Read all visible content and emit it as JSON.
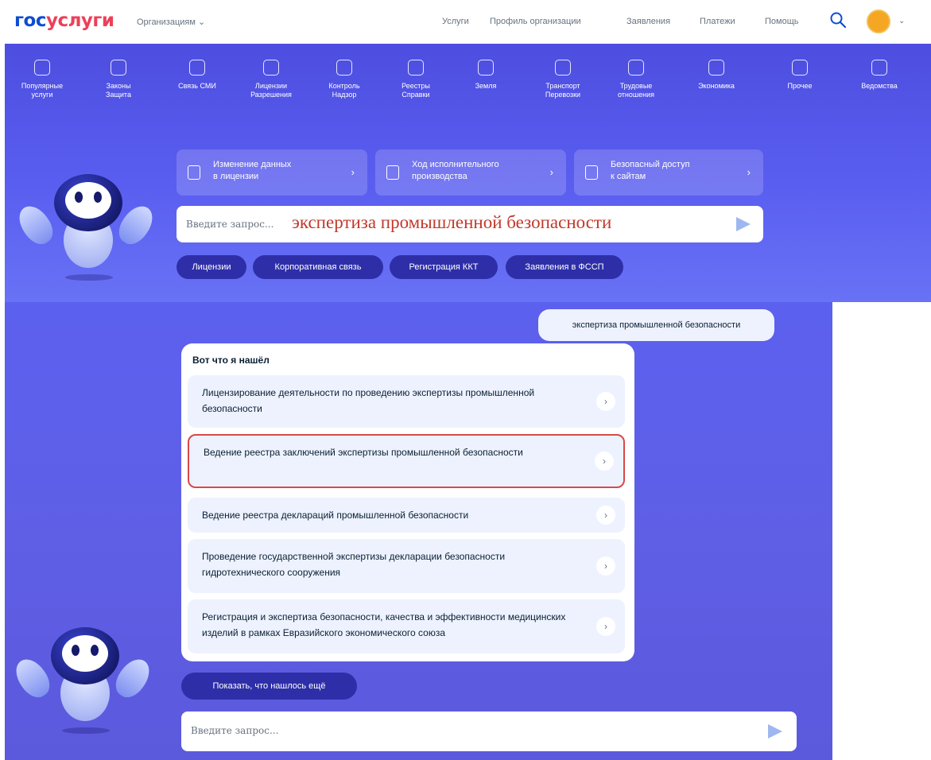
{
  "header": {
    "logo_part1": "гос",
    "logo_part2": "услуги",
    "org_menu": "Организациям ⌄",
    "nav": [
      "Услуги",
      "Профиль организации",
      "Заявления",
      "Платежи",
      "Помощь"
    ],
    "avatar_chevron": "⌄"
  },
  "categories": [
    {
      "label": "Популярные\nуслуги",
      "icon": "heart-icon"
    },
    {
      "label": "Законы\nЗащита",
      "icon": "hammer-icon"
    },
    {
      "label": "Связь СМИ",
      "icon": "antenna-icon"
    },
    {
      "label": "Лицензии\nРазрешения",
      "icon": "document-icon"
    },
    {
      "label": "Контроль\nНадзор",
      "icon": "edit-icon"
    },
    {
      "label": "Реестры\nСправки",
      "icon": "folder-icon"
    },
    {
      "label": "Земля",
      "icon": "house-icon"
    },
    {
      "label": "Транспорт\nПеревозки",
      "icon": "car-icon"
    },
    {
      "label": "Трудовые\nотношения",
      "icon": "briefcase-icon"
    },
    {
      "label": "Экономика",
      "icon": "bag-icon"
    },
    {
      "label": "Прочее",
      "icon": "grid-icon"
    },
    {
      "label": "Ведомства",
      "icon": "emblem-icon"
    }
  ],
  "quick_cards": [
    {
      "label": "Изменение данных\nв лицензии",
      "chevron": "›"
    },
    {
      "label": "Ход исполнительного\nпроизводства",
      "chevron": "›"
    },
    {
      "label": "Безопасный доступ\nк сайтам",
      "chevron": "›"
    }
  ],
  "top_search": {
    "placeholder": "Введите запрос...",
    "query": "экспертиза промышленной безопасности"
  },
  "chips": [
    "Лицензии",
    "Корпоративная связь",
    "Регистрация ККТ",
    "Заявления в ФССП"
  ],
  "chat": {
    "user_message": "экспертиза промышленной безопасности",
    "results_title": "Вот что я нашёл",
    "results": [
      {
        "text": "Лицензирование деятельности по проведению экспертизы промышленной безопасности",
        "arrow": "›"
      },
      {
        "text": "Ведение реестра заключений экспертизы промышленной безопасности",
        "arrow": "›",
        "highlighted": true
      },
      {
        "text": "Ведение реестра деклараций промышленной безопасности",
        "arrow": "›"
      },
      {
        "text": "Проведение государственной экспертизы декларации безопасности гидротехнического сооружения",
        "arrow": "›"
      },
      {
        "text": "Регистрация и экспертиза безопасности, качества и эффективности медицинских изделий в рамках Евразийского экономического союза",
        "arrow": "›"
      }
    ],
    "show_more": "Показать, что нашлось ещё",
    "input_placeholder": "Введите запрос..."
  },
  "colors": {
    "brand_blue": "#0d4cd3",
    "brand_red": "#ee3f58",
    "banner": "#5a5ef0",
    "chip": "#2e2fa8",
    "card": "#edf2fe",
    "highlight": "#d94848"
  }
}
